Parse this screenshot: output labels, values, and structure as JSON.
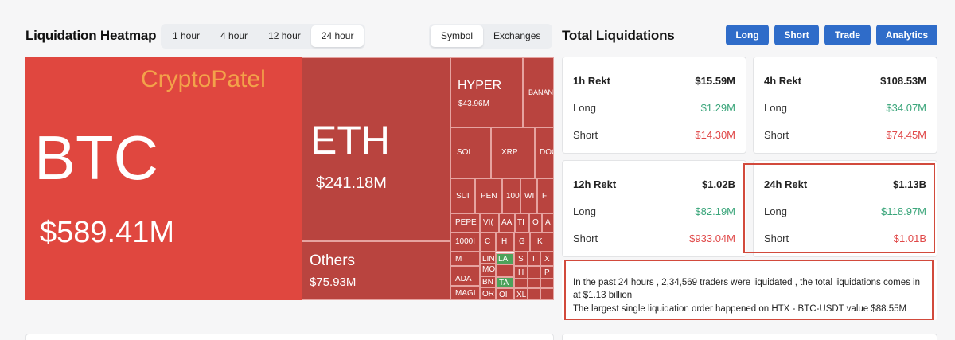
{
  "heatmap": {
    "title": "Liquidation Heatmap",
    "timeframes": [
      "1 hour",
      "4 hour",
      "12 hour",
      "24 hour"
    ],
    "active_timeframe": "24 hour",
    "views": [
      "Symbol",
      "Exchanges"
    ],
    "active_view": "Symbol",
    "watermark": "CryptoPatel",
    "tiles": {
      "btc": {
        "symbol": "BTC",
        "value": "$589.41M"
      },
      "eth": {
        "symbol": "ETH",
        "value": "$241.18M"
      },
      "others": {
        "symbol": "Others",
        "value": "$75.93M"
      },
      "hype": {
        "symbol": "HYPER",
        "value": "$43.96M"
      },
      "bana": {
        "symbol": "BANAN"
      },
      "sol": {
        "symbol": "SOL"
      },
      "xrp": {
        "symbol": "XRP"
      },
      "doge": {
        "symbol": "DOG"
      },
      "sui": {
        "symbol": "SUI"
      },
      "pen": {
        "symbol": "PEN"
      },
      "t100": {
        "symbol": "100"
      },
      "wif": {
        "symbol": "WI"
      },
      "f": {
        "symbol": "F"
      },
      "pepe": {
        "symbol": "PEPE"
      },
      "vi": {
        "symbol": "VI("
      },
      "aa": {
        "symbol": "AA"
      },
      "ti": {
        "symbol": "TI"
      },
      "o": {
        "symbol": "O"
      },
      "a1": {
        "symbol": "A"
      },
      "k1000": {
        "symbol": "1000I"
      },
      "c": {
        "symbol": "C"
      },
      "h": {
        "symbol": "H"
      },
      "g": {
        "symbol": "G"
      },
      "k": {
        "symbol": "K"
      },
      "m": {
        "symbol": "M"
      },
      "lin": {
        "symbol": "LIN"
      },
      "la": {
        "symbol": "LA"
      },
      "s": {
        "symbol": "S"
      },
      "i": {
        "symbol": "I"
      },
      "x": {
        "symbol": "X"
      },
      "mo": {
        "symbol": "MO"
      },
      "h2": {
        "symbol": "H"
      },
      "p": {
        "symbol": "P"
      },
      "ada": {
        "symbol": "ADA"
      },
      "bn": {
        "symbol": "BN"
      },
      "ta": {
        "symbol": "TA"
      },
      "mag": {
        "symbol": "MAGI"
      },
      "or": {
        "symbol": "OR"
      },
      "ol": {
        "symbol": "OI"
      },
      "xl": {
        "symbol": "XL"
      }
    }
  },
  "liquidations": {
    "title": "Total Liquidations",
    "buttons": [
      "Long",
      "Short",
      "Trade",
      "Analytics"
    ],
    "cards": [
      {
        "label": "1h Rekt",
        "total": "$15.59M",
        "long_label": "Long",
        "long": "$1.29M",
        "short_label": "Short",
        "short": "$14.30M"
      },
      {
        "label": "4h Rekt",
        "total": "$108.53M",
        "long_label": "Long",
        "long": "$34.07M",
        "short_label": "Short",
        "short": "$74.45M"
      },
      {
        "label": "12h Rekt",
        "total": "$1.02B",
        "long_label": "Long",
        "long": "$82.19M",
        "short_label": "Short",
        "short": "$933.04M"
      },
      {
        "label": "24h Rekt",
        "total": "$1.13B",
        "long_label": "Long",
        "long": "$118.97M",
        "short_label": "Short",
        "short": "$1.01B"
      }
    ],
    "summary_line1": "In the past 24 hours , 2,34,569 traders were liquidated , the total liquidations comes in at $1.13 billion",
    "summary_line2": "The largest single liquidation order happened on HTX - BTC-USDT value $88.55M"
  },
  "colors": {
    "accent": "#2f6cc9",
    "btc": "#e0473f",
    "tile": "#b9443f",
    "green": "#3aa57a",
    "red": "#e04848",
    "highlight": "#d24a3c"
  }
}
